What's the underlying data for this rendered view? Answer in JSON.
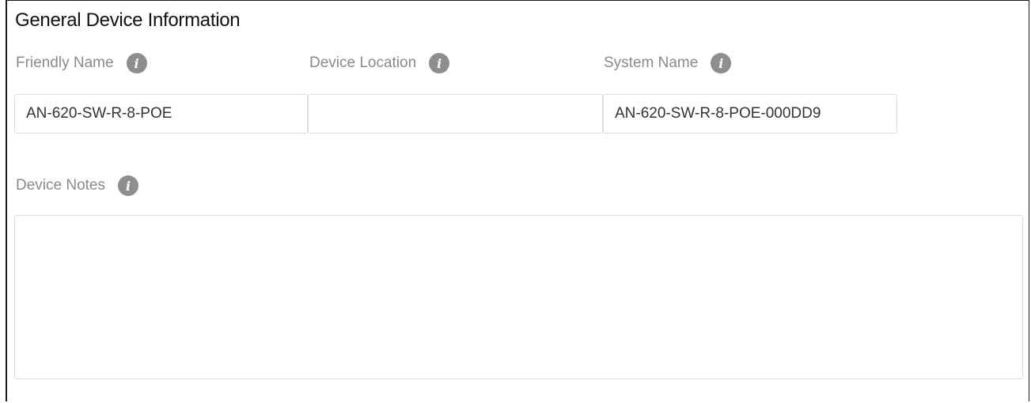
{
  "section": {
    "title": "General Device Information"
  },
  "fields": {
    "friendly_name": {
      "label": "Friendly Name",
      "value": "AN-620-SW-R-8-POE",
      "info_icon": "info-icon"
    },
    "device_location": {
      "label": "Device Location",
      "value": "",
      "info_icon": "info-icon"
    },
    "system_name": {
      "label": "System Name",
      "value": "AN-620-SW-R-8-POE-000DD9",
      "info_icon": "info-icon"
    },
    "device_notes": {
      "label": "Device Notes",
      "value": "",
      "info_icon": "info-icon"
    }
  },
  "colors": {
    "label_text": "#8a8a8a",
    "icon_background": "#8e8e8e",
    "input_border": "#dcdcdc",
    "title_text": "#111111"
  }
}
